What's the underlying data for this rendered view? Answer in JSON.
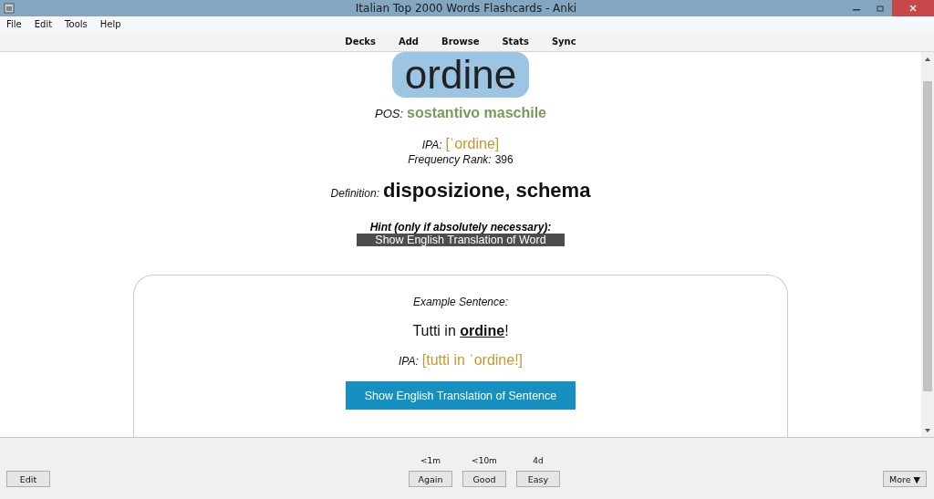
{
  "window": {
    "title": "Italian Top 2000 Words Flashcards - Anki"
  },
  "menu": [
    "File",
    "Edit",
    "Tools",
    "Help"
  ],
  "toolbar": [
    "Decks",
    "Add",
    "Browse",
    "Stats",
    "Sync"
  ],
  "card": {
    "word": "ordine",
    "pos": {
      "label": "POS:",
      "value": "sostantivo maschile"
    },
    "ipa": {
      "label": "IPA:",
      "value": "[ˈordine]"
    },
    "rank": {
      "label": "Frequency Rank:",
      "value": "396"
    },
    "definition": {
      "label": "Definition:",
      "value": "disposizione, schema"
    },
    "hint": "Hint (only if absolutely necessary):",
    "word_button": "Show English Translation of Word",
    "example": {
      "label": "Example Sentence:",
      "sentence": "Tutti in **ordine**!",
      "ipa_label": "IPA:",
      "ipa": "[tutti in ˈordine!]",
      "button": "Show English Translation of Sentence"
    }
  },
  "bottom": {
    "edit": "Edit",
    "answers": [
      {
        "time": "<1m",
        "label": "Again"
      },
      {
        "time": "<10m",
        "label": "Good"
      },
      {
        "time": "4d",
        "label": "Easy"
      }
    ],
    "more": "More ▼"
  }
}
